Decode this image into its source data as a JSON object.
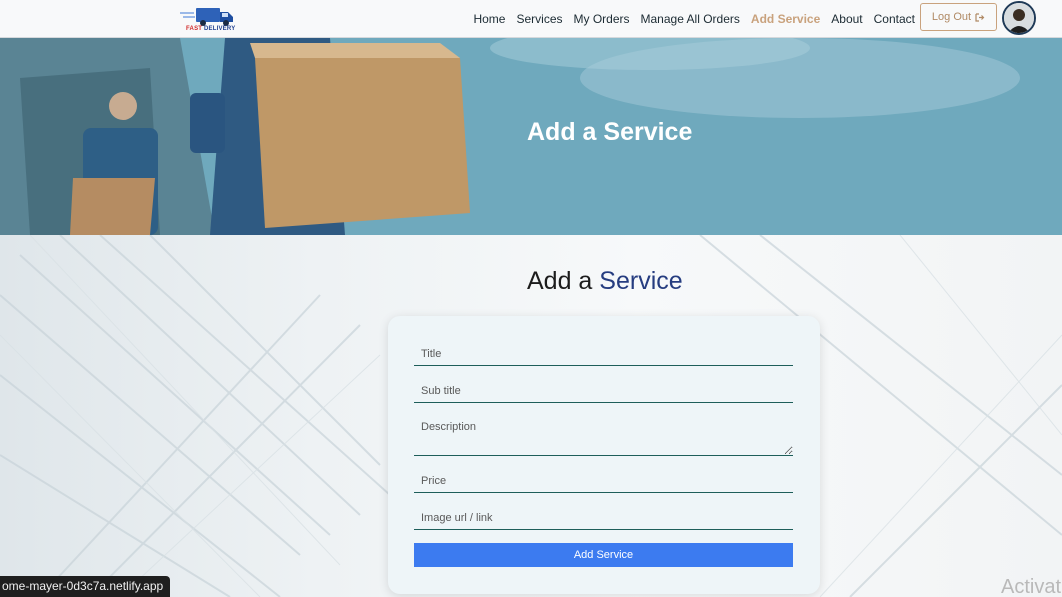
{
  "navbar": {
    "logo_text_1": "FAST",
    "logo_text_2": "DELIVERY",
    "links": [
      {
        "label": "Home"
      },
      {
        "label": "Services"
      },
      {
        "label": "My Orders"
      },
      {
        "label": "Manage All Orders"
      },
      {
        "label": "Add Service"
      },
      {
        "label": "About"
      },
      {
        "label": "Contact"
      }
    ],
    "active_link": "Add Service",
    "logout_label": "Log Out",
    "logout_icon": "sign-out-icon"
  },
  "hero": {
    "title": "Add a Service"
  },
  "form_section": {
    "title_part1": "Add a",
    "title_part2": "Service",
    "fields": {
      "title_placeholder": "Title",
      "subtitle_placeholder": "Sub title",
      "description_placeholder": "Description",
      "price_placeholder": "Price",
      "image_placeholder": "Image url / link"
    },
    "submit_label": "Add Service"
  },
  "status_bar": {
    "url": "ome-mayer-0d3c7a.netlify.app"
  },
  "os_watermark": "Activat",
  "colors": {
    "accent": "#263d80",
    "active_nav": "#c9a27d",
    "button": "#3c7bf0",
    "field_border": "#1d5e5a"
  }
}
